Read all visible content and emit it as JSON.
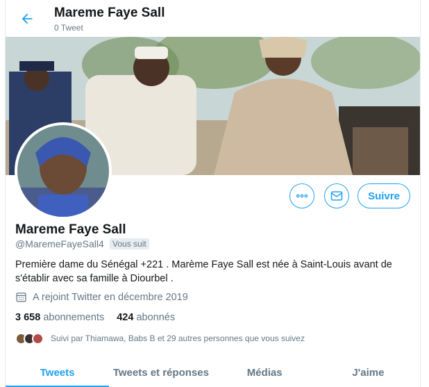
{
  "header": {
    "name": "Mareme Faye Sall",
    "tweet_count": "0 Tweet"
  },
  "profile": {
    "name": "Mareme Faye Sall",
    "handle": "@MaremeFayeSall4",
    "follows_you_badge": "Vous suit",
    "bio_line1": "Première dame du Sénégal +221 . Marème Faye Sall est née à Saint-Louis avant de",
    "bio_line2": "s'établir  avec sa famille à Diourbel .",
    "joined": "A rejoint Twitter en décembre 2019",
    "following_count": "3 658",
    "following_label": "abonnements",
    "followers_count": "424",
    "followers_label": "abonnés",
    "followed_by": "Suivi par Thiamawa, Babs B et 29 autres personnes que vous suivez"
  },
  "actions": {
    "more_icon": "more-icon",
    "message_icon": "envelope-icon",
    "follow_label": "Suivre"
  },
  "tabs": [
    {
      "label": "Tweets",
      "active": true
    },
    {
      "label": "Tweets et réponses",
      "active": false
    },
    {
      "label": "Médias",
      "active": false
    },
    {
      "label": "J'aime",
      "active": false
    }
  ],
  "colors": {
    "accent": "#1da1f2",
    "secondary_text": "#657786",
    "primary_text": "#14171a"
  }
}
